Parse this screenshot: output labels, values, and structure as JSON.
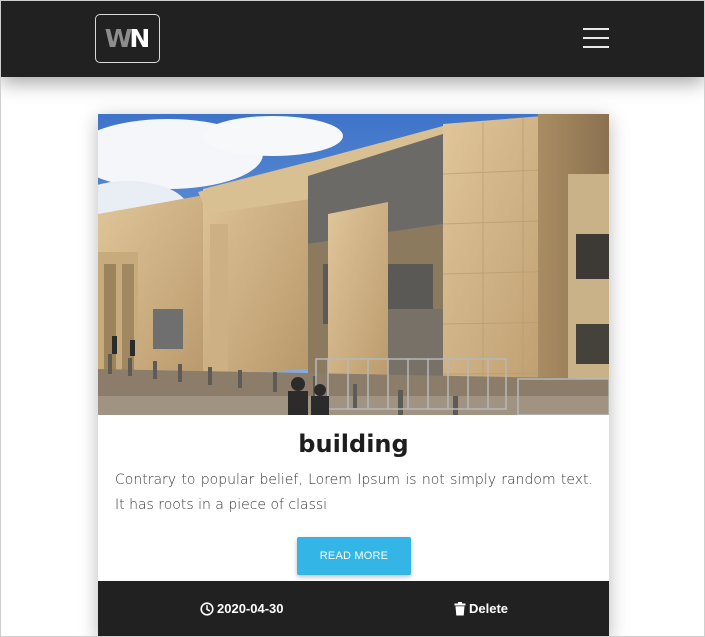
{
  "navbar": {
    "logo": {
      "letter_1": "W",
      "letter_2": "N"
    },
    "menu_icon": "hamburger-menu-icon"
  },
  "post": {
    "image_alt": "Photo of a building",
    "title": "building",
    "excerpt": "Contrary to popular belief, Lorem Ipsum is not simply random text. It has roots in a piece of classi",
    "read_more_label": "READ MORE",
    "date_icon": "clock-icon",
    "date": "2020-04-30",
    "delete_icon": "trash-icon",
    "delete_label": "Delete"
  },
  "colors": {
    "navbar_bg": "#212121",
    "accent_button": "#33b5e5",
    "footer_bg": "#212121"
  }
}
